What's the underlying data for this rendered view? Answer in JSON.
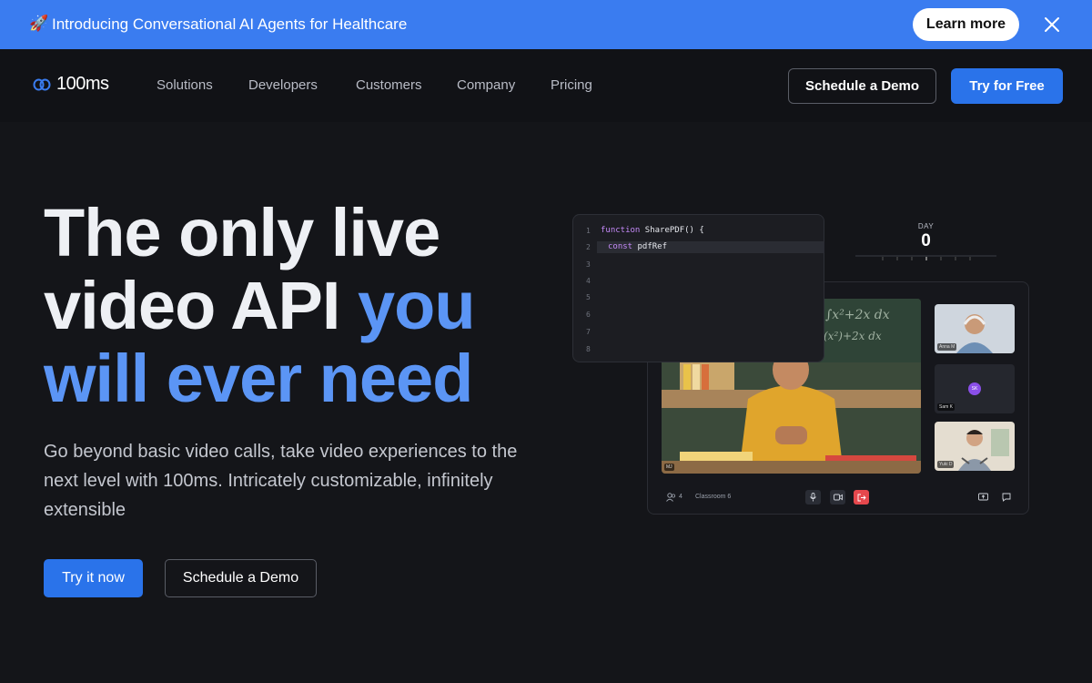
{
  "announcement": {
    "rocket": "🚀",
    "text": "Introducing Conversational AI Agents for Healthcare",
    "button": "Learn more"
  },
  "nav": {
    "brand": "100ms",
    "items": [
      "Solutions",
      "Developers",
      "Customers",
      "Company",
      "Pricing"
    ],
    "demo_button": "Schedule a Demo",
    "free_button": "Try for Free"
  },
  "hero": {
    "title_line1": "The only live",
    "title_line2_a": "video API ",
    "title_line2_b": "you",
    "title_line3": "will ever need",
    "subtitle": "Go beyond basic video calls, take video experiences to the next level with 100ms. Intricately customizable, infinitely extensible",
    "try_button": "Try it now",
    "demo_button": "Schedule a Demo"
  },
  "illustration": {
    "code_lines": [
      {
        "n": "1",
        "kw": "function",
        "rest": " SharePDF() {"
      },
      {
        "n": "2",
        "kw": "const",
        "rest": " pdfRef"
      },
      {
        "n": "3",
        "kw": "",
        "rest": ""
      },
      {
        "n": "4",
        "kw": "",
        "rest": ""
      },
      {
        "n": "5",
        "kw": "",
        "rest": ""
      },
      {
        "n": "6",
        "kw": "",
        "rest": ""
      },
      {
        "n": "7",
        "kw": "",
        "rest": ""
      },
      {
        "n": "8",
        "kw": "",
        "rest": ""
      }
    ],
    "day_label": "DAY",
    "day_value": "0",
    "main_tile_label": "MJ",
    "thumb_labels": [
      "Anna M",
      "Sam K",
      "Yuki D"
    ],
    "avatar_initials": "SK",
    "participants_count": "4",
    "room_name": "Classroom 6"
  },
  "colors": {
    "banner": "#3a7cf0",
    "accent_text": "#5b95f5",
    "primary_button": "#2a73ea",
    "leave_button": "#e5484d"
  }
}
